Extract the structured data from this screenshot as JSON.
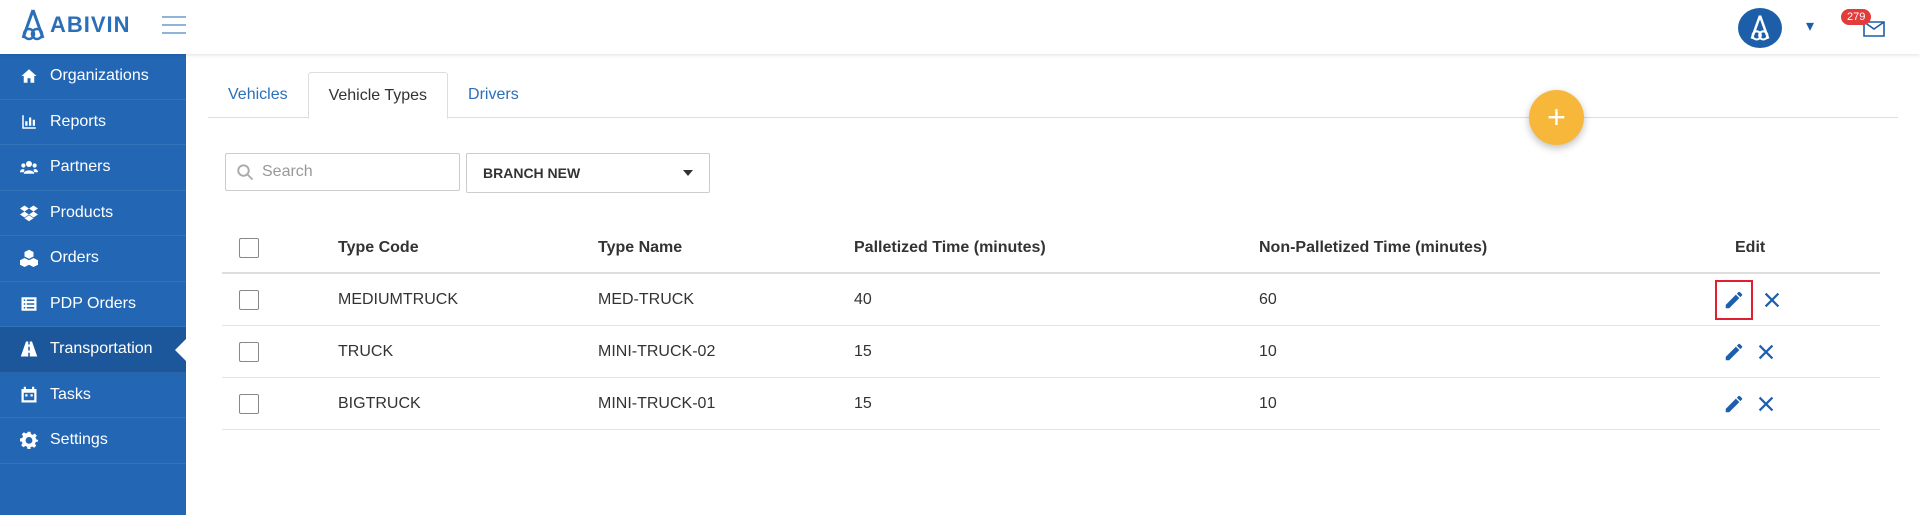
{
  "brand": {
    "name": "ABIVIN",
    "color": "#2366b4"
  },
  "header": {
    "notification_count": "279"
  },
  "sidebar": {
    "items": [
      {
        "label": "Organizations",
        "icon": "home-icon"
      },
      {
        "label": "Reports",
        "icon": "bar-chart-icon"
      },
      {
        "label": "Partners",
        "icon": "users-icon"
      },
      {
        "label": "Products",
        "icon": "dropbox-icon"
      },
      {
        "label": "Orders",
        "icon": "cubes-icon"
      },
      {
        "label": "PDP Orders",
        "icon": "list-icon"
      },
      {
        "label": "Transportation",
        "icon": "road-icon",
        "active": true
      },
      {
        "label": "Tasks",
        "icon": "calendar-icon"
      },
      {
        "label": "Settings",
        "icon": "gear-icon"
      }
    ]
  },
  "tabs": [
    {
      "label": "Vehicles"
    },
    {
      "label": "Vehicle Types",
      "active": true
    },
    {
      "label": "Drivers"
    }
  ],
  "filters": {
    "search_placeholder": "Search",
    "branch_selected": "BRANCH NEW"
  },
  "table": {
    "columns": [
      "Type Code",
      "Type Name",
      "Palletized Time (minutes)",
      "Non-Palletized Time (minutes)",
      "Edit"
    ],
    "rows": [
      {
        "type_code": "MEDIUMTRUCK",
        "type_name": "MED-TRUCK",
        "palletized": "40",
        "non_palletized": "60"
      },
      {
        "type_code": "TRUCK",
        "type_name": "MINI-TRUCK-02",
        "palletized": "15",
        "non_palletized": "10"
      },
      {
        "type_code": "BIGTRUCK",
        "type_name": "MINI-TRUCK-01",
        "palletized": "15",
        "non_palletized": "10"
      }
    ]
  },
  "colors": {
    "fab": "#f7b73a",
    "badge": "#e23b3b",
    "highlight": "#e02030"
  }
}
